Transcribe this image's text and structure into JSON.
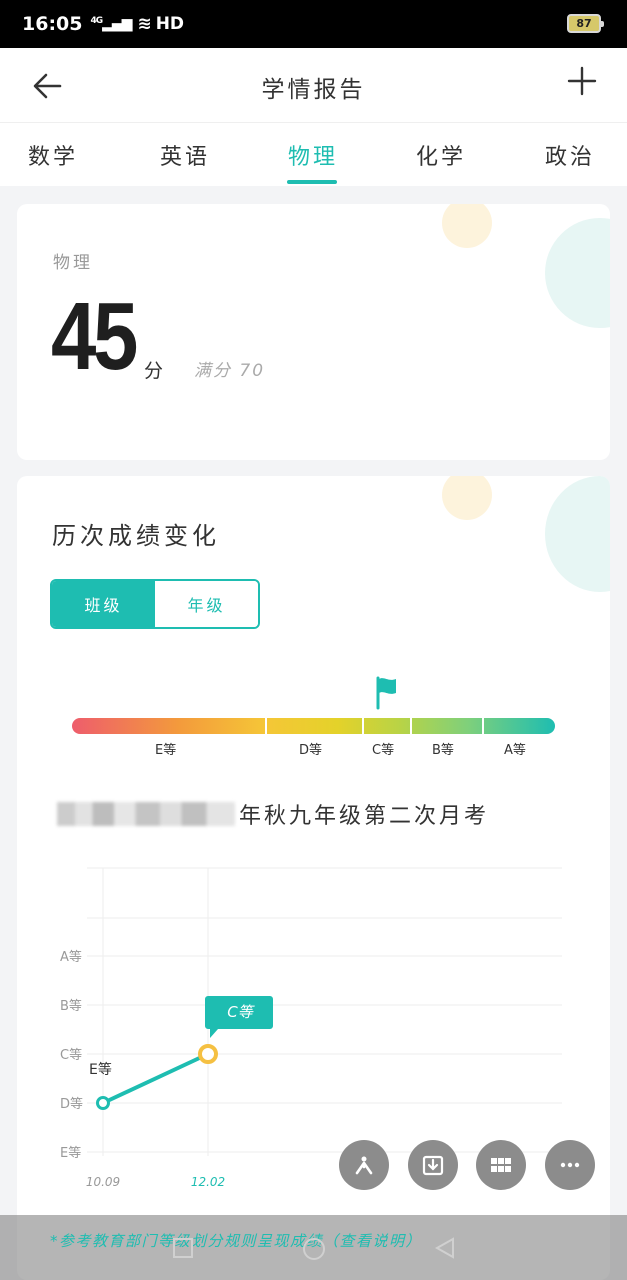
{
  "status": {
    "time": "16:05",
    "network": "4G",
    "hd": "HD",
    "battery": "87"
  },
  "header": {
    "title": "学情报告",
    "back_icon": "arrow-left-icon",
    "add_icon": "plus-icon"
  },
  "tabs": [
    {
      "label": "数学",
      "active": false
    },
    {
      "label": "英语",
      "active": false
    },
    {
      "label": "物理",
      "active": true
    },
    {
      "label": "化学",
      "active": false
    },
    {
      "label": "政治",
      "active": false
    }
  ],
  "score_card": {
    "subject": "物理",
    "score": "45",
    "unit": "分",
    "full": "满分 70"
  },
  "history": {
    "title": "历次成绩变化",
    "toggle": {
      "class_label": "班级",
      "grade_label": "年级",
      "selected": "班级"
    },
    "grade_scale": [
      "E等",
      "D等",
      "C等",
      "B等",
      "A等"
    ],
    "current_grade": "C等",
    "exam_name": "年秋九年级第二次月考"
  },
  "chart_data": {
    "type": "line",
    "y_categories": [
      "A等",
      "B等",
      "C等",
      "D等",
      "E等"
    ],
    "x": [
      "10.09",
      "12.02"
    ],
    "series": [
      {
        "values": [
          "D等",
          "C等"
        ],
        "point_labels": [
          "E等",
          "C等"
        ]
      }
    ],
    "colors": {
      "line": "#1ebdb1",
      "highlight_point": "#f5c042",
      "tooltip": "#1ebdb1"
    },
    "grid": true
  },
  "fab_icons": [
    "share-icon",
    "download-icon",
    "grid-icon",
    "more-icon"
  ],
  "footnote": "*参考教育部门等级划分规则呈现成绩（查看说明）",
  "colors": {
    "accent": "#1ebdb1"
  }
}
